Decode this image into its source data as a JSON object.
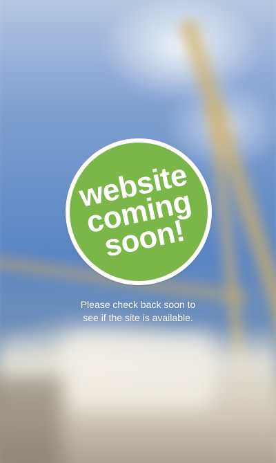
{
  "badge": {
    "line1": "website",
    "line2": "coming",
    "line3": "soon!",
    "fill_color": "#7ab648",
    "ring_color": "#ffffff"
  },
  "message": {
    "line1": "Please check back soon to",
    "line2": "see if the site is available."
  }
}
